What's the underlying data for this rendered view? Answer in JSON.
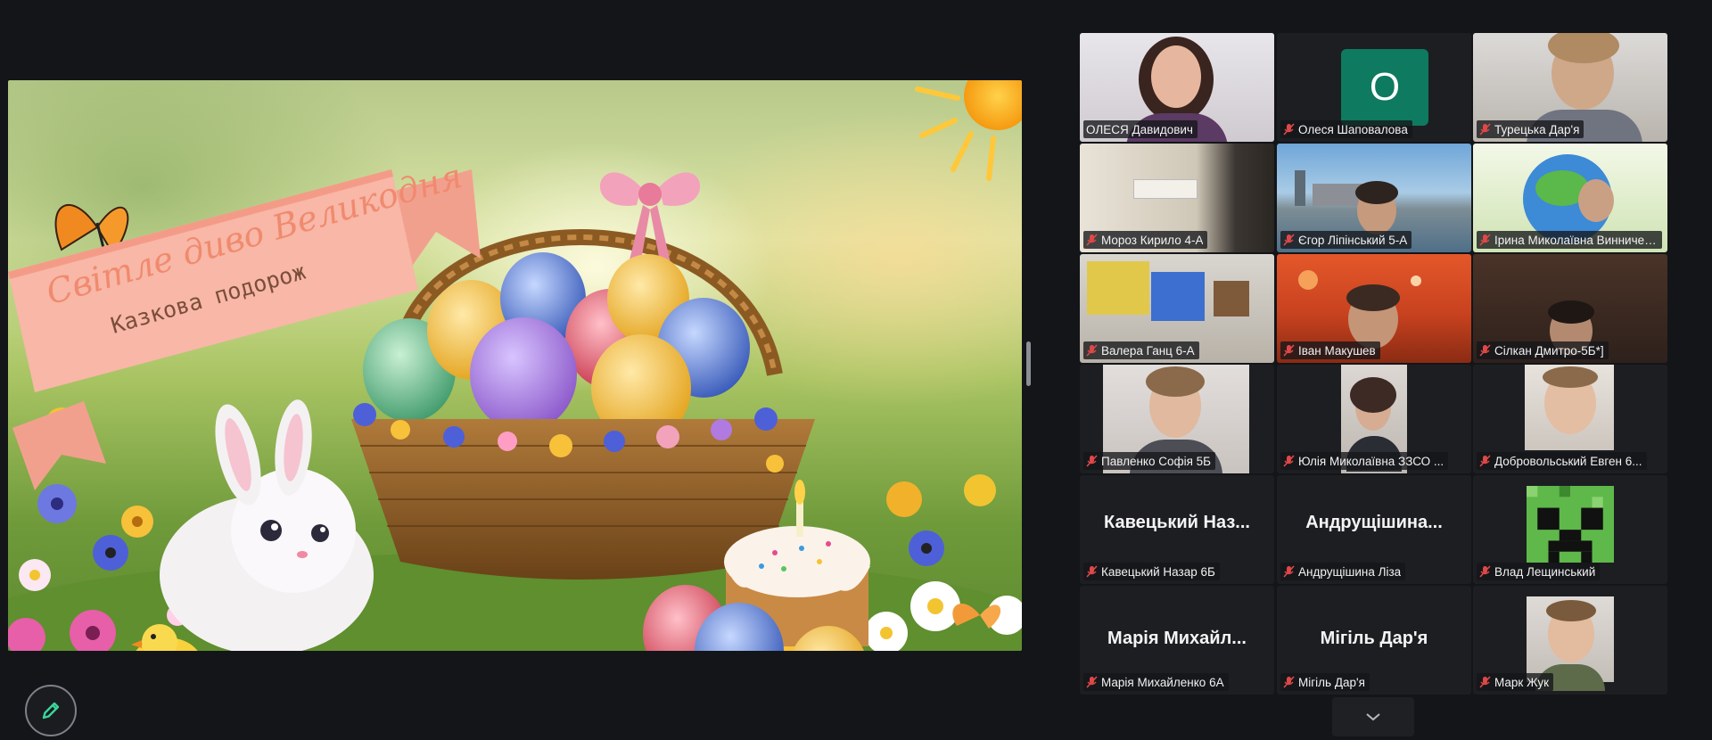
{
  "share": {
    "banner_title": "Світле диво Великодня",
    "banner_subtitle": "Казкова подорож"
  },
  "colors": {
    "background": "#131519",
    "active_speaker_border": "#3ad69b",
    "muted_mic": "#e04848",
    "avatar_bg": "#0e7a5f"
  },
  "participants": [
    {
      "name": "ОЛЕСЯ Давидович",
      "muted": false,
      "active": true,
      "display": "video"
    },
    {
      "name": "Олеся Шаповалова",
      "muted": true,
      "display": "avatar",
      "avatar_letter": "О"
    },
    {
      "name": "Турецька Дар'я",
      "muted": true,
      "display": "video"
    },
    {
      "name": "Мороз Кирило 4-А",
      "muted": true,
      "display": "video"
    },
    {
      "name": "Єгор Ліпінський 5-А",
      "muted": true,
      "display": "video"
    },
    {
      "name": "Ірина Миколаївна Винниченко",
      "muted": true,
      "display": "video"
    },
    {
      "name": "Валера Ганц 6-А",
      "muted": true,
      "display": "video"
    },
    {
      "name": "Іван Макушев",
      "muted": true,
      "display": "video"
    },
    {
      "name": "Сілкан Дмитро-5Б*]",
      "muted": true,
      "display": "video"
    },
    {
      "name": "Павленко Софія 5Б",
      "muted": true,
      "display": "video"
    },
    {
      "name": "Юлія Миколаївна ЗЗСО ...",
      "muted": true,
      "display": "video"
    },
    {
      "name": "Добровольський Евген 6...",
      "muted": true,
      "display": "video"
    },
    {
      "name": "Кавецький Назар 6Б",
      "muted": true,
      "display": "name",
      "big_name": "Кавецький  Наз..."
    },
    {
      "name": "Андрущішина Ліза",
      "muted": true,
      "display": "name",
      "big_name": "Андрущішина..."
    },
    {
      "name": "Влад Лещинський",
      "muted": true,
      "display": "image"
    },
    {
      "name": "Марія Михайленко 6А",
      "muted": true,
      "display": "name",
      "big_name": "Марія  Михайл..."
    },
    {
      "name": "Мігіль Дар'я",
      "muted": true,
      "display": "name",
      "big_name": "Мігіль Дар'я"
    },
    {
      "name": "Марк Жук",
      "muted": true,
      "display": "video"
    }
  ],
  "icons": {
    "annotate": "pencil-icon",
    "gallery_next": "chevron-down-icon",
    "mic": "mic-muted-icon"
  }
}
